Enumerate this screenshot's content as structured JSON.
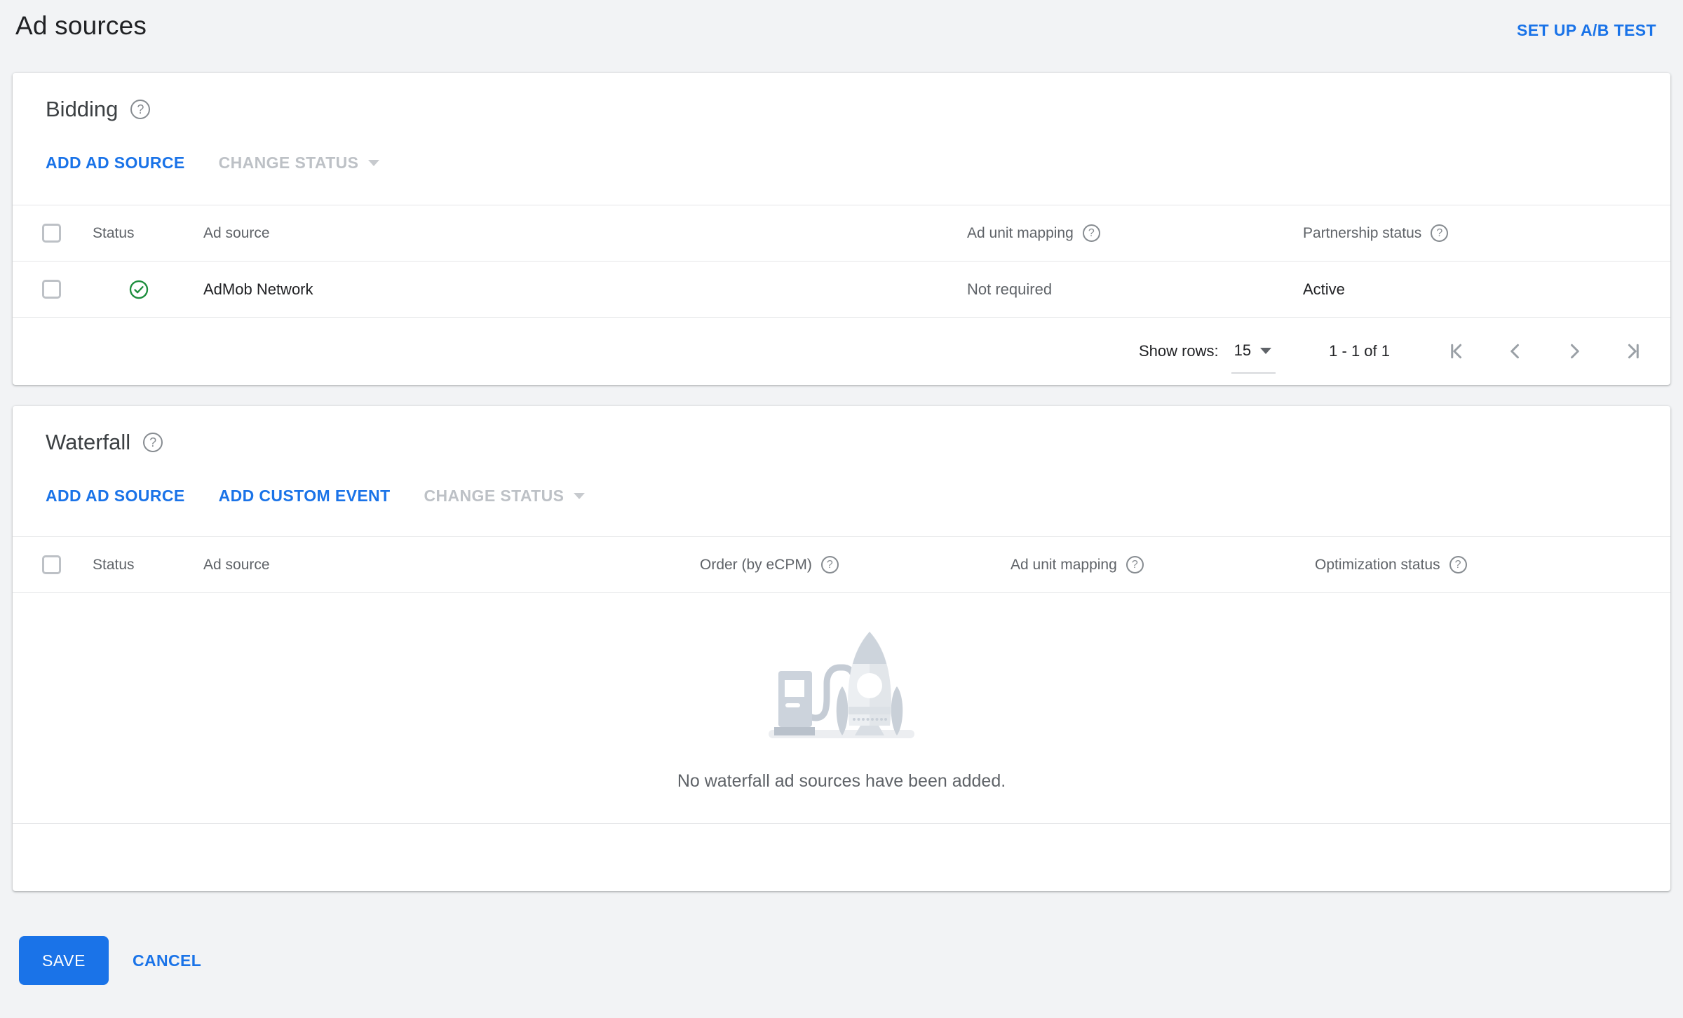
{
  "header": {
    "title": "Ad sources",
    "ab_test_link": "SET UP A/B TEST"
  },
  "bidding": {
    "title": "Bidding",
    "actions": {
      "add_ad_source": "ADD AD SOURCE",
      "change_status": "CHANGE STATUS"
    },
    "columns": {
      "status": "Status",
      "ad_source": "Ad source",
      "ad_unit_mapping": "Ad unit mapping",
      "partnership_status": "Partnership status"
    },
    "row": {
      "status_icon": "active-check-green",
      "ad_source": "AdMob Network",
      "ad_unit_mapping": "Not required",
      "partnership_status": "Active"
    },
    "pagination": {
      "show_rows_label": "Show rows:",
      "rows_value": "15",
      "range": "1 - 1 of 1",
      "icons": [
        "first-page",
        "previous-page",
        "next-page",
        "last-page"
      ]
    }
  },
  "waterfall": {
    "title": "Waterfall",
    "actions": {
      "add_ad_source": "ADD AD SOURCE",
      "add_custom_event": "ADD CUSTOM EVENT",
      "change_status": "CHANGE STATUS"
    },
    "columns": {
      "status": "Status",
      "ad_source": "Ad source",
      "order": "Order (by eCPM)",
      "ad_unit_mapping": "Ad unit mapping",
      "optimization_status": "Optimization status"
    },
    "empty_message": "No waterfall ad sources have been added.",
    "empty_illustration": "rocket-and-fuel-pump"
  },
  "footer": {
    "save": "SAVE",
    "cancel": "CANCEL"
  },
  "colors": {
    "accent_blue": "#1a73e8",
    "success_green": "#1e8e3e",
    "disabled_gray": "#bdc1c6",
    "page_background": "#f2f3f5"
  }
}
